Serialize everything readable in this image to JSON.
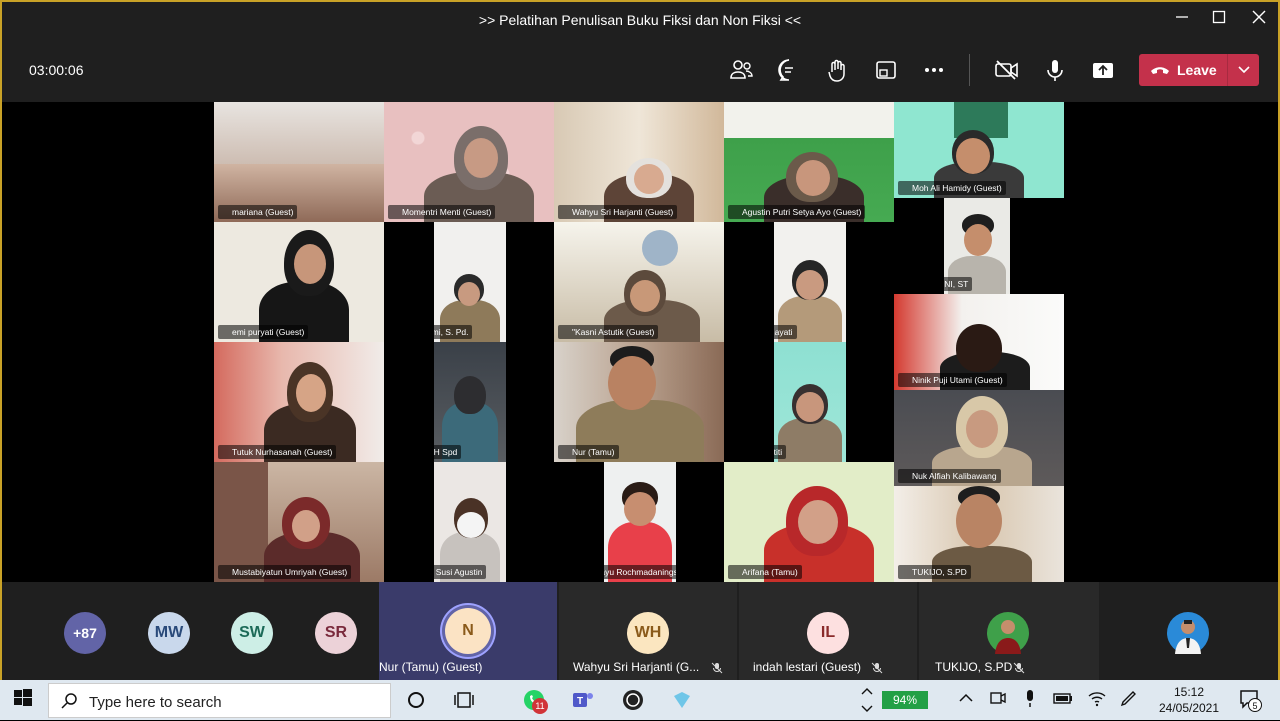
{
  "window": {
    "title": ">> Pelatihan Penulisan Buku Fiksi dan Non Fiksi <<"
  },
  "toolbar": {
    "timer": "03:00:06",
    "leave_label": "Leave",
    "icons": [
      "participants-icon",
      "chat-icon",
      "raise-hand-icon",
      "share-tray-icon",
      "more-icon",
      "camera-off-icon",
      "mic-icon",
      "share-icon",
      "phone-hangup-icon"
    ]
  },
  "participants": [
    {
      "name": "mariana (Guest)"
    },
    {
      "name": "Momentri Menti (Guest)"
    },
    {
      "name": "Wahyu Sri Harjanti (Guest)"
    },
    {
      "name": "Agustin Putri Setya Ayo (Guest)"
    },
    {
      "name": "Moh Ali Hamidy (Guest)"
    },
    {
      "name": "WAHRONI, ST"
    },
    {
      "name": "emi puryati (Guest)"
    },
    {
      "name": "Y. Sutarmi, S. Pd."
    },
    {
      "name": "\"Kasni Astutik (Guest)"
    },
    {
      "name": "Eis Nurhayati"
    },
    {
      "name": "Ninik Puji Utami (Guest)"
    },
    {
      "name": "Tutuk Nurhasanah (Guest)"
    },
    {
      "name": "KUSRIAH Spd"
    },
    {
      "name": "Nur (Tamu)"
    },
    {
      "name": "Dwi Nastiti"
    },
    {
      "name": "Nuk Alfiah Kalibawang"
    },
    {
      "name": "Mustabiyatun Umriyah (Guest)"
    },
    {
      "name": "Tri Fena Susi Agustin"
    },
    {
      "name": "Sri Rahayu Rochmadaningsih"
    },
    {
      "name": "Arifana (Tamu)"
    },
    {
      "name": "TUKIJO, S.PD"
    }
  ],
  "roster": {
    "overflow": "+87",
    "avatars": [
      {
        "initials": "MW",
        "color": "#c9d8ec"
      },
      {
        "initials": "SW",
        "color": "#cdeee6"
      },
      {
        "initials": "SR",
        "color": "#ecd2d8"
      }
    ],
    "tiles": [
      {
        "initials": "N",
        "name": "Nur (Tamu) (Guest)"
      },
      {
        "initials": "WH",
        "name": "Wahyu Sri Harjanti (G..."
      },
      {
        "initials": "IL",
        "name": "indah lestari (Guest)"
      },
      {
        "initials": "",
        "name": "TUKIJO, S.PD"
      }
    ]
  },
  "taskbar": {
    "search_placeholder": "Type here to search",
    "whatsapp_badge": "11",
    "battery": "94%",
    "time": "15:12",
    "date": "24/05/2021",
    "notifications": "5"
  }
}
